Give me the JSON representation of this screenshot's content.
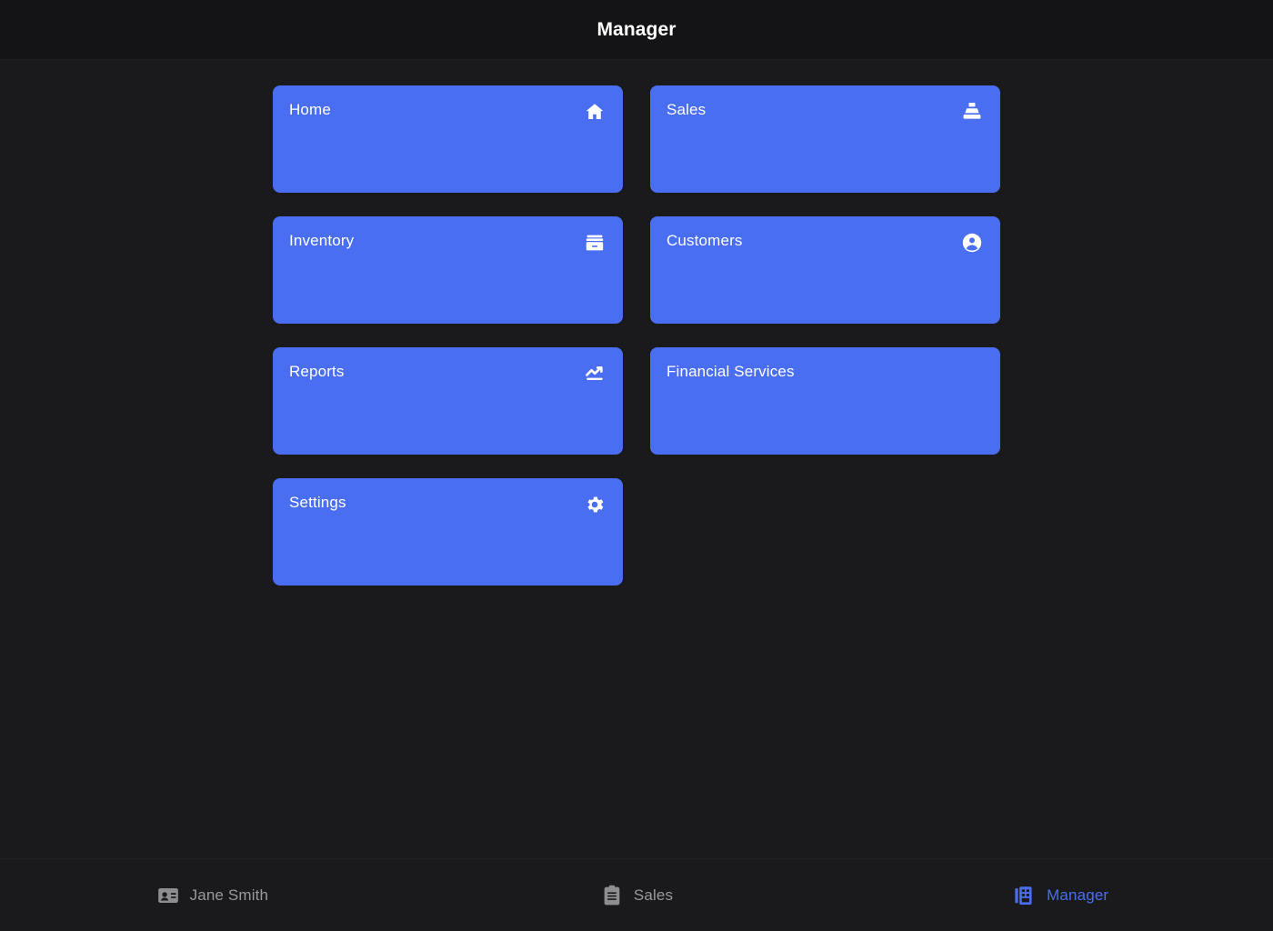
{
  "theme": {
    "accent": "#4a6ef2",
    "page_bg": "#1a1a1c",
    "header_bg": "#141416",
    "card_text": "#ffffff",
    "nav_inactive": "#9a9a9c",
    "nav_active": "#4a6ef2"
  },
  "header": {
    "title": "Manager"
  },
  "main": {
    "cards": [
      {
        "label": "Home",
        "icon": "home-icon"
      },
      {
        "label": "Sales",
        "icon": "point-of-sale-icon"
      },
      {
        "label": "Inventory",
        "icon": "inventory-box-icon"
      },
      {
        "label": "Customers",
        "icon": "account-circle-icon"
      },
      {
        "label": "Reports",
        "icon": "trending-up-chart-icon"
      },
      {
        "label": "Financial Services",
        "icon": ""
      },
      {
        "label": "Settings",
        "icon": "gear-icon"
      }
    ]
  },
  "bottom_nav": {
    "items": [
      {
        "label": "Jane Smith",
        "icon": "contact-badge-icon",
        "active": false
      },
      {
        "label": "Sales",
        "icon": "clipboard-icon",
        "active": false
      },
      {
        "label": "Manager",
        "icon": "business-building-icon",
        "active": true
      }
    ]
  }
}
